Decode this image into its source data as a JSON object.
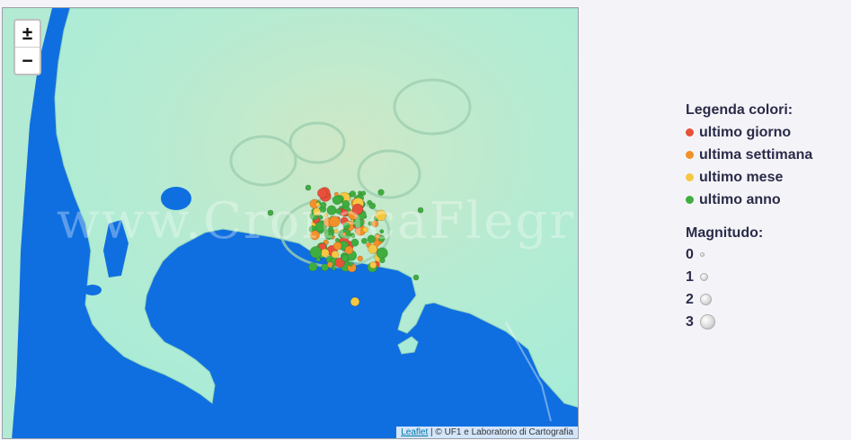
{
  "map": {
    "zoom_in_label": "±",
    "zoom_out_label": "−",
    "attribution_link": "Leaflet",
    "attribution_text": " | © UF1 e Laboratorio di Cartografia",
    "watermark": "www.CronacaFlegrea.it",
    "sea_color": "#0f6fe0",
    "land_color": "#b7e9cf"
  },
  "legend": {
    "title": "Legenda colori:",
    "items": [
      {
        "label": "ultimo giorno",
        "color": "#e8503a"
      },
      {
        "label": "ultima settimana",
        "color": "#f2902a"
      },
      {
        "label": "ultimo mese",
        "color": "#f5c842"
      },
      {
        "label": "ultimo anno",
        "color": "#3fae3f"
      }
    ],
    "magnitude_title": "Magnitudo:",
    "magnitudes": [
      "0",
      "1",
      "2",
      "3"
    ]
  }
}
